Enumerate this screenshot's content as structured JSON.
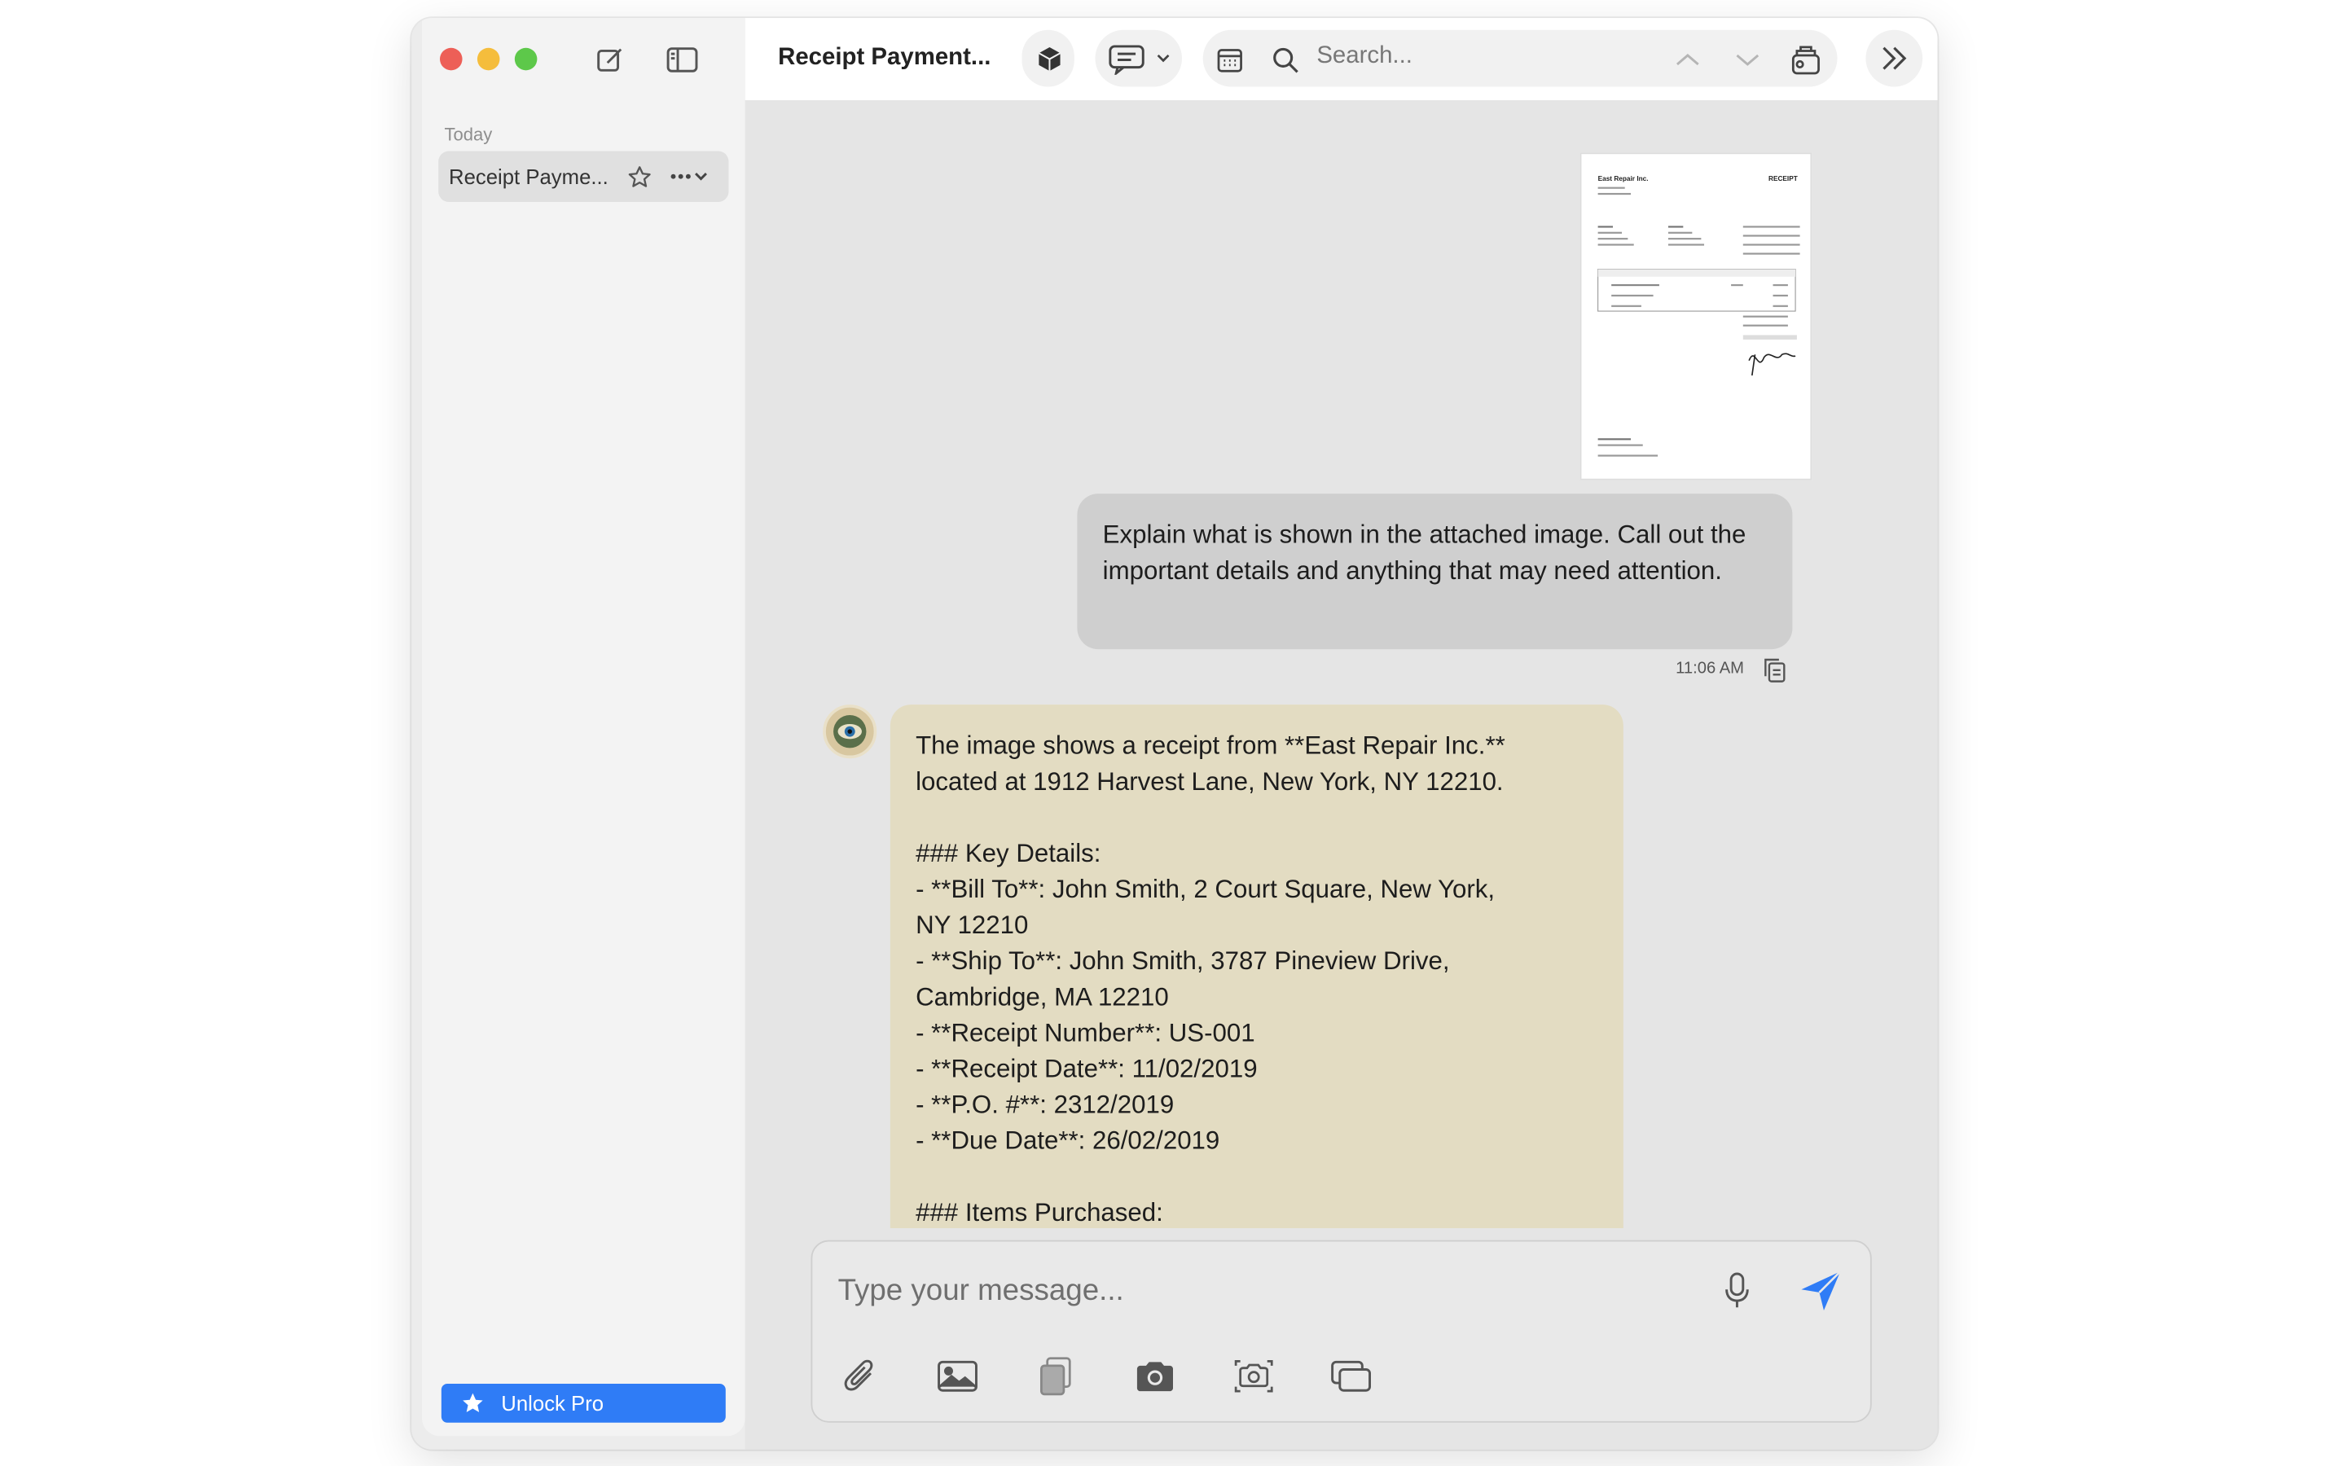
{
  "window": {
    "title": "Receipt Payment..."
  },
  "sidebar": {
    "section_label": "Today",
    "items": [
      {
        "label": "Receipt Payme..."
      }
    ],
    "unlock_label": "Unlock Pro"
  },
  "toolbar": {
    "search_placeholder": "Search...",
    "icons": [
      "compose-icon",
      "sidebar-toggle-icon",
      "cube-icon",
      "chat-bubbles-icon",
      "calendar-icon",
      "search-icon",
      "chevron-up-icon",
      "chevron-down-icon",
      "clear-icon",
      "double-chevron-right-icon"
    ]
  },
  "conversation": {
    "attachment": {
      "type": "receipt-image",
      "company": "East Repair Inc.",
      "heading": "RECEIPT"
    },
    "user_message": {
      "text": "Explain what is shown in the attached image. Call out the important details and anything that may need attention.",
      "time": "11:06 AM"
    },
    "assistant_message": {
      "lines": [
        "The image shows a receipt from **East Repair Inc.**",
        "located at 1912 Harvest Lane, New York, NY 12210.",
        "",
        "### Key Details:",
        "- **Bill To**: John Smith, 2 Court Square, New York,",
        "NY 12210",
        "- **Ship To**: John Smith, 3787 Pineview Drive,",
        "Cambridge, MA 12210",
        "- **Receipt Number**: US-001",
        "- **Receipt Date**: 11/02/2019",
        "- **P.O. #**: 2312/2019",
        "- **Due Date**: 26/02/2019",
        "",
        "### Items Purchased:"
      ]
    }
  },
  "composer": {
    "placeholder": "Type your message..."
  },
  "colors": {
    "accent": "#2f7cf6",
    "assistant_bubble": "#e3dcc2",
    "user_bubble": "#cfcfcf"
  }
}
